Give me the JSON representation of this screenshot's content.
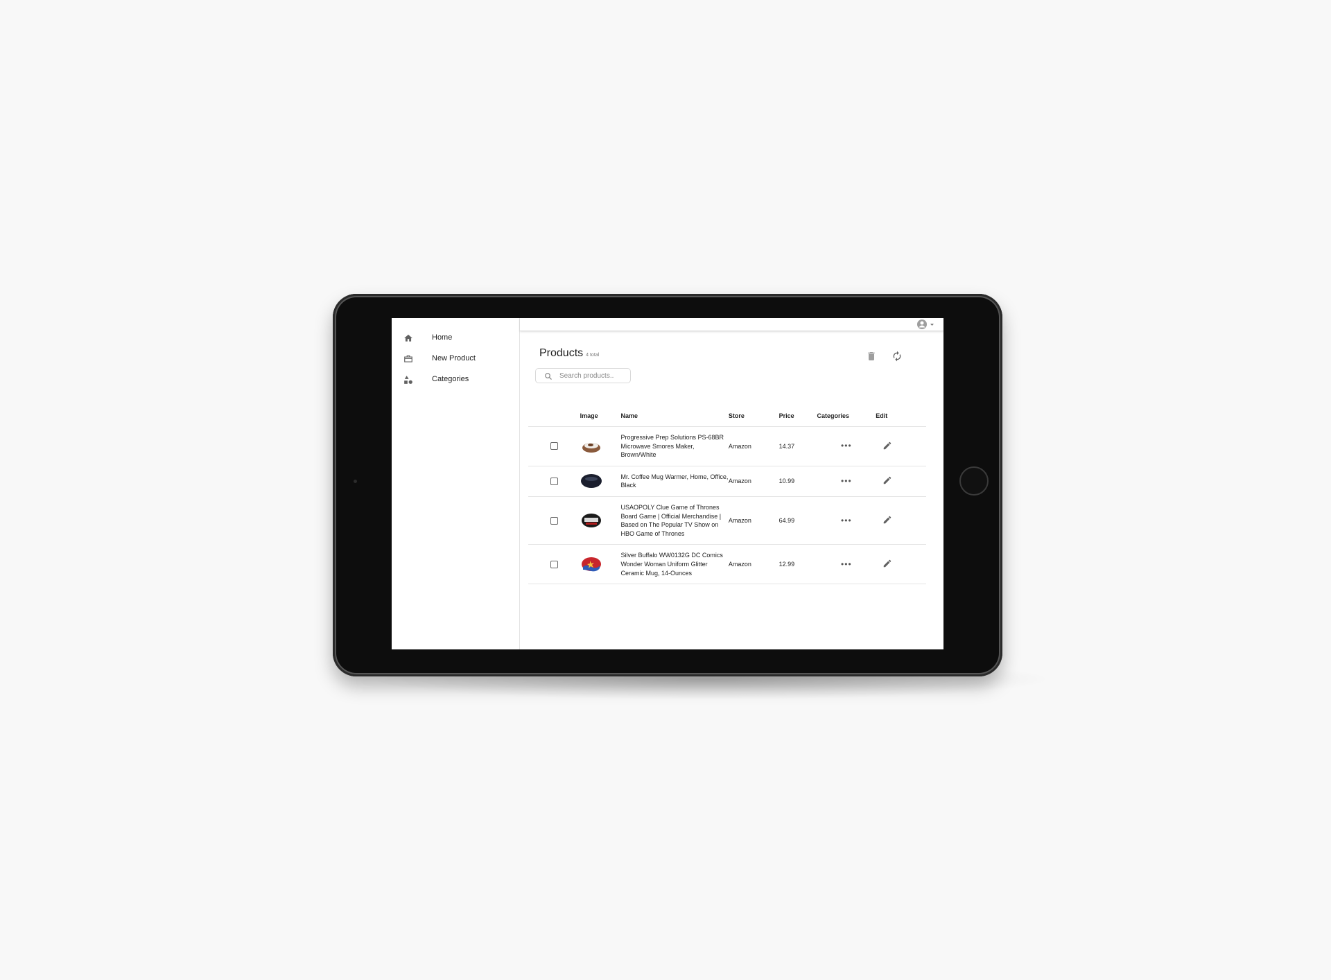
{
  "sidebar": {
    "items": [
      {
        "label": "Home",
        "icon": "home-icon"
      },
      {
        "label": "New Product",
        "icon": "box-icon"
      },
      {
        "label": "Categories",
        "icon": "shapes-icon"
      }
    ]
  },
  "topbar": {
    "account_icon": "account-circle-icon"
  },
  "page": {
    "title": "Products",
    "count": "4 total",
    "delete_icon": "trash-icon",
    "refresh_icon": "refresh-icon"
  },
  "search": {
    "placeholder": "Search products.."
  },
  "table": {
    "headers": [
      "Image",
      "Name",
      "Store",
      "Price",
      "Categories",
      "Edit"
    ],
    "rows": [
      {
        "name": "Progressive Prep Solutions PS-68BR Microwave Smores Maker, Brown/White",
        "store": "Amazon",
        "price": "14.37"
      },
      {
        "name": "Mr. Coffee Mug Warmer, Home, Office, Black",
        "store": "Amazon",
        "price": "10.99"
      },
      {
        "name": "USAOPOLY Clue Game of Thrones Board Game | Official Merchandise | Based on The Popular TV Show on HBO Game of Thrones",
        "store": "Amazon",
        "price": "64.99"
      },
      {
        "name": "Silver Buffalo WW0132G DC Comics Wonder Woman Uniform Glitter Ceramic Mug, 14-Ounces",
        "store": "Amazon",
        "price": "12.99"
      }
    ]
  },
  "colors": {
    "background": "#f8f8f8",
    "bezel": "#0d0d0d",
    "screen": "#ffffff",
    "icon": "#616161"
  }
}
